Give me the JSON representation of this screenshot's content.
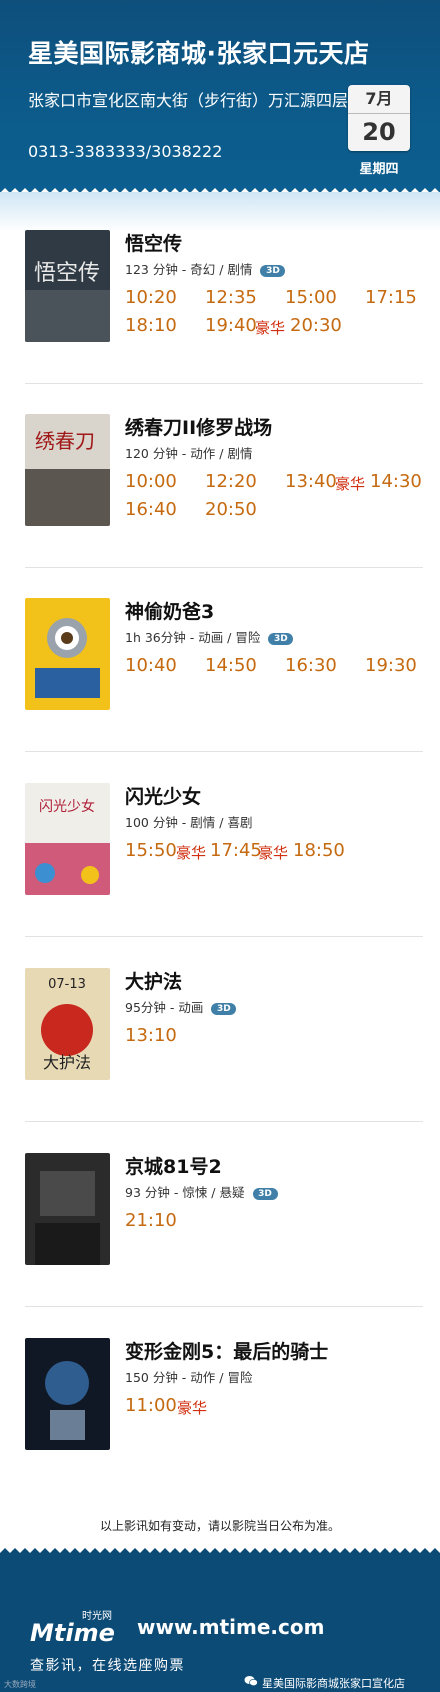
{
  "cinema": {
    "name": "星美国际影商城·张家口元天店",
    "address": "张家口市宣化区南大街（步行街）万汇源四层",
    "phone": "0313-3383333/3038222"
  },
  "date": {
    "month": "7月",
    "day": "20",
    "weekday": "星期四"
  },
  "movies": [
    {
      "title": "悟空传",
      "meta": "123 分钟 - 奇幻 / 剧情",
      "badge": "3D",
      "showtimes": [
        "10:20",
        "12:35",
        "15:00",
        "17:15",
        "18:10",
        "19:40",
        "20:30"
      ],
      "vip": [
        "豪华"
      ]
    },
    {
      "title": "绣春刀II修罗战场",
      "meta": "120 分钟 - 动作 / 剧情",
      "badge": "",
      "showtimes": [
        "10:00",
        "12:20",
        "13:40",
        "14:30",
        "16:40",
        "20:50"
      ],
      "vip": [
        "豪华"
      ]
    },
    {
      "title": "神偷奶爸3",
      "meta": "1h  36分钟 - 动画 / 冒险",
      "badge": "3D",
      "showtimes": [
        "10:40",
        "14:50",
        "16:30",
        "19:30"
      ],
      "vip": []
    },
    {
      "title": "闪光少女",
      "meta": "100 分钟 - 剧情 / 喜剧",
      "badge": "",
      "showtimes": [
        "15:50",
        "17:45",
        "18:50"
      ],
      "vip": [
        "豪华",
        "豪华"
      ]
    },
    {
      "title": "大护法",
      "meta": "95分钟 - 动画",
      "badge": "3D",
      "showtimes": [
        "13:10"
      ],
      "vip": []
    },
    {
      "title": "京城81号2",
      "meta": "93 分钟 - 惊悚 / 悬疑",
      "badge": "3D",
      "showtimes": [
        "21:10"
      ],
      "vip": []
    },
    {
      "title": "变形金刚5：最后的骑士",
      "meta": "150 分钟 - 动作 / 冒险",
      "badge": "",
      "showtimes": [
        "11:00"
      ],
      "vip": [
        "豪华"
      ]
    }
  ],
  "notice": "以上影讯如有变动，请以影院当日公布为准。",
  "footer": {
    "brand_cn": "时光网",
    "brand": "Mtime",
    "site": "www.mtime.com",
    "slogan": "查影讯，在线选座购票",
    "wechat": "星美国际影商城张家口宣化店",
    "corner": "大数跨境"
  },
  "colors": {
    "header": "#0d4b77",
    "time": "#c56a10",
    "vip": "#d03010",
    "badge": "#3f7fa8"
  }
}
